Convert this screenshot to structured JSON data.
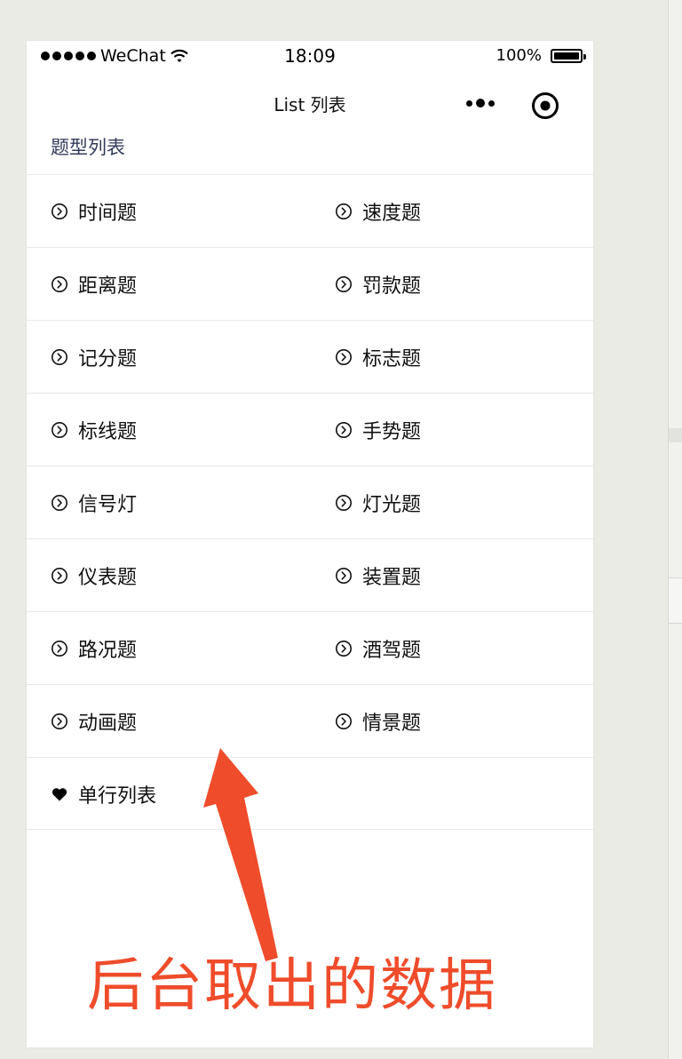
{
  "status_bar": {
    "carrier": "WeChat",
    "time": "18:09",
    "battery": "100%"
  },
  "nav": {
    "title": "List 列表"
  },
  "section": {
    "title": "题型列表"
  },
  "grid": [
    [
      "时间题",
      "速度题"
    ],
    [
      "距离题",
      "罚款题"
    ],
    [
      "记分题",
      "标志题"
    ],
    [
      "标线题",
      "手势题"
    ],
    [
      "信号灯",
      "灯光题"
    ],
    [
      "仪表题",
      "装置题"
    ],
    [
      "路况题",
      "酒驾题"
    ],
    [
      "动画题",
      "情景题"
    ]
  ],
  "single_row": {
    "label": "单行列表"
  },
  "annotation": {
    "text": "后台取出的数据",
    "color": "#ef4c2b"
  },
  "icons": {
    "grid_item": "chevron-circle-right-icon",
    "single_row": "heart-icon"
  }
}
